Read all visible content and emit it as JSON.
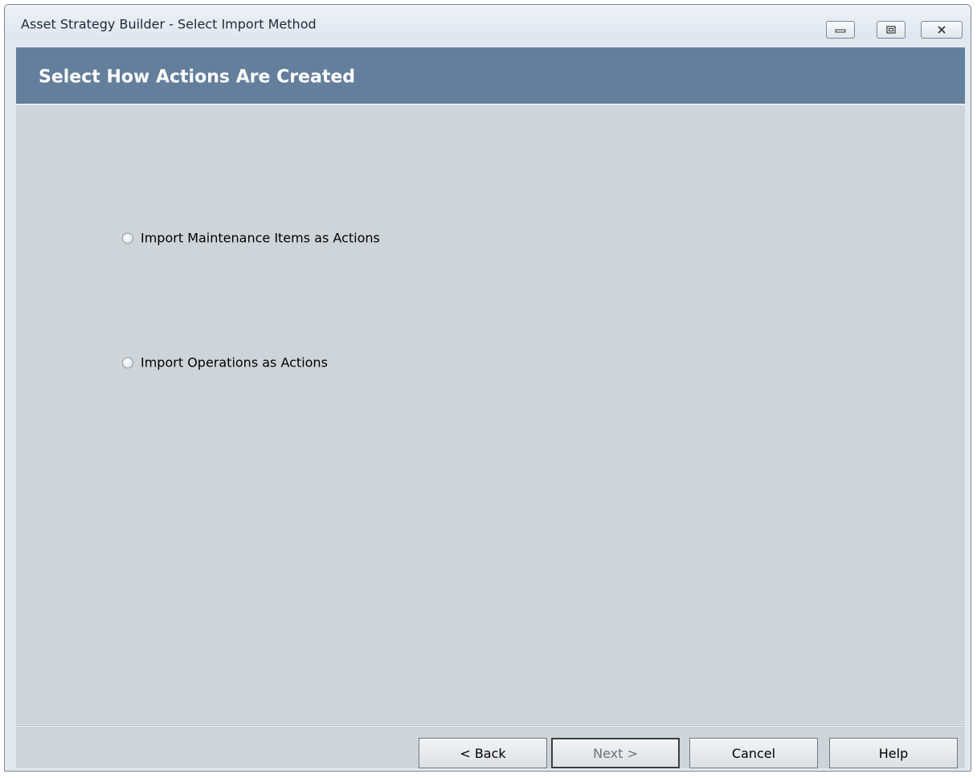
{
  "window": {
    "title": "Asset Strategy Builder - Select Import Method"
  },
  "header": {
    "title": "Select How Actions Are Created"
  },
  "options": [
    {
      "label": "Import Maintenance Items as Actions",
      "selected": false
    },
    {
      "label": "Import Operations as Actions",
      "selected": false
    }
  ],
  "footer": {
    "back_label": "< Back",
    "next_label": "Next >",
    "cancel_label": "Cancel",
    "help_label": "Help"
  },
  "icons": {
    "minimize": "minimize-icon",
    "maximize": "maximize-icon",
    "close": "close-icon"
  },
  "colors": {
    "header_bg": "#647f9c",
    "content_bg": "#cfd4d8"
  }
}
